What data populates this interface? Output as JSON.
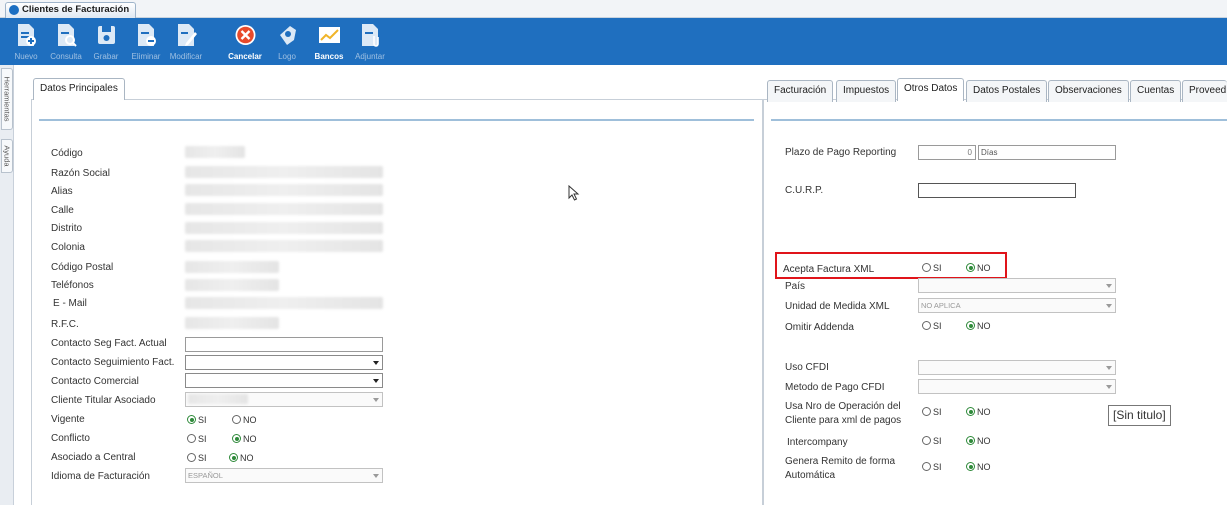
{
  "window": {
    "tab_title": "Clientes de Facturación"
  },
  "toolbar": [
    {
      "name": "nuevo",
      "label": "Nuevo",
      "active": false
    },
    {
      "name": "consulta",
      "label": "Consulta",
      "active": false
    },
    {
      "name": "grabar",
      "label": "Grabar",
      "active": false
    },
    {
      "name": "eliminar",
      "label": "Eliminar",
      "active": false
    },
    {
      "name": "modificar",
      "label": "Modificar",
      "active": false
    },
    {
      "name": "cancelar",
      "label": "Cancelar",
      "active": true
    },
    {
      "name": "logo",
      "label": "Logo",
      "active": false
    },
    {
      "name": "bancos",
      "label": "Bancos",
      "active": true
    },
    {
      "name": "adjuntar",
      "label": "Adjuntar",
      "active": false
    }
  ],
  "side_tabs": [
    "Herramientas",
    "Ayuda"
  ],
  "left_panel": {
    "tab": "Datos Principales",
    "labels": {
      "codigo": "Código",
      "razon_social": "Razón Social",
      "alias": "Alias",
      "calle": "Calle",
      "distrito": "Distrito",
      "colonia": "Colonia",
      "codigo_postal": "Código Postal",
      "telefonos": "Teléfonos",
      "email": "E - Mail",
      "rfc": "R.F.C.",
      "contacto_seg_fact_actual": "Contacto Seg Fact. Actual",
      "contacto_seguimiento_fact": "Contacto Seguimiento Fact.",
      "contacto_comercial": "Contacto Comercial",
      "cliente_titular": "Cliente Titular Asociado",
      "vigente": "Vigente",
      "conflicto": "Conflicto",
      "asociado_central": "Asociado a Central",
      "idioma": "Idioma de Facturación"
    },
    "idioma_value": "ESPAÑOL",
    "radio_si": "SI",
    "radio_no": "NO",
    "vigente": "SI",
    "conflicto": "NO",
    "asociado_central": "NO"
  },
  "right_panel": {
    "tabs": [
      "Facturación",
      "Impuestos",
      "Otros Datos",
      "Datos Postales",
      "Observaciones",
      "Cuentas",
      "Proveed"
    ],
    "active_tab": "Otros Datos",
    "plazo_label": "Plazo de Pago Reporting",
    "plazo_value": "0",
    "plazo_unit": "Días",
    "curp_label": "C.U.R.P.",
    "acepta_xml_label": "Acepta Factura XML",
    "acepta_xml": "NO",
    "pais_label": "País",
    "unidad_label": "Unidad de Medida XML",
    "unidad_value": "NO APLICA",
    "omitir_label": "Omitir Addenda",
    "omitir": "NO",
    "uso_cfdi_label": "Uso CFDI",
    "metodo_pago_label": "Metodo de Pago CFDI",
    "usa_nro_label_1": "Usa Nro de Operación del",
    "usa_nro_label_2": "Cliente para xml de pagos",
    "usa_nro": "NO",
    "intercompany_label": "Intercompany",
    "intercompany": "NO",
    "genera_label_1": "Genera Remito de forma",
    "genera_label_2": "Automática",
    "genera": "NO",
    "radio_si": "SI",
    "radio_no": "NO"
  },
  "tooltip": "[Sin titulo]",
  "colors": {
    "toolbar": "#1f6fbf",
    "highlight": "#e0141a",
    "radio_on": "#2f8a3a"
  }
}
